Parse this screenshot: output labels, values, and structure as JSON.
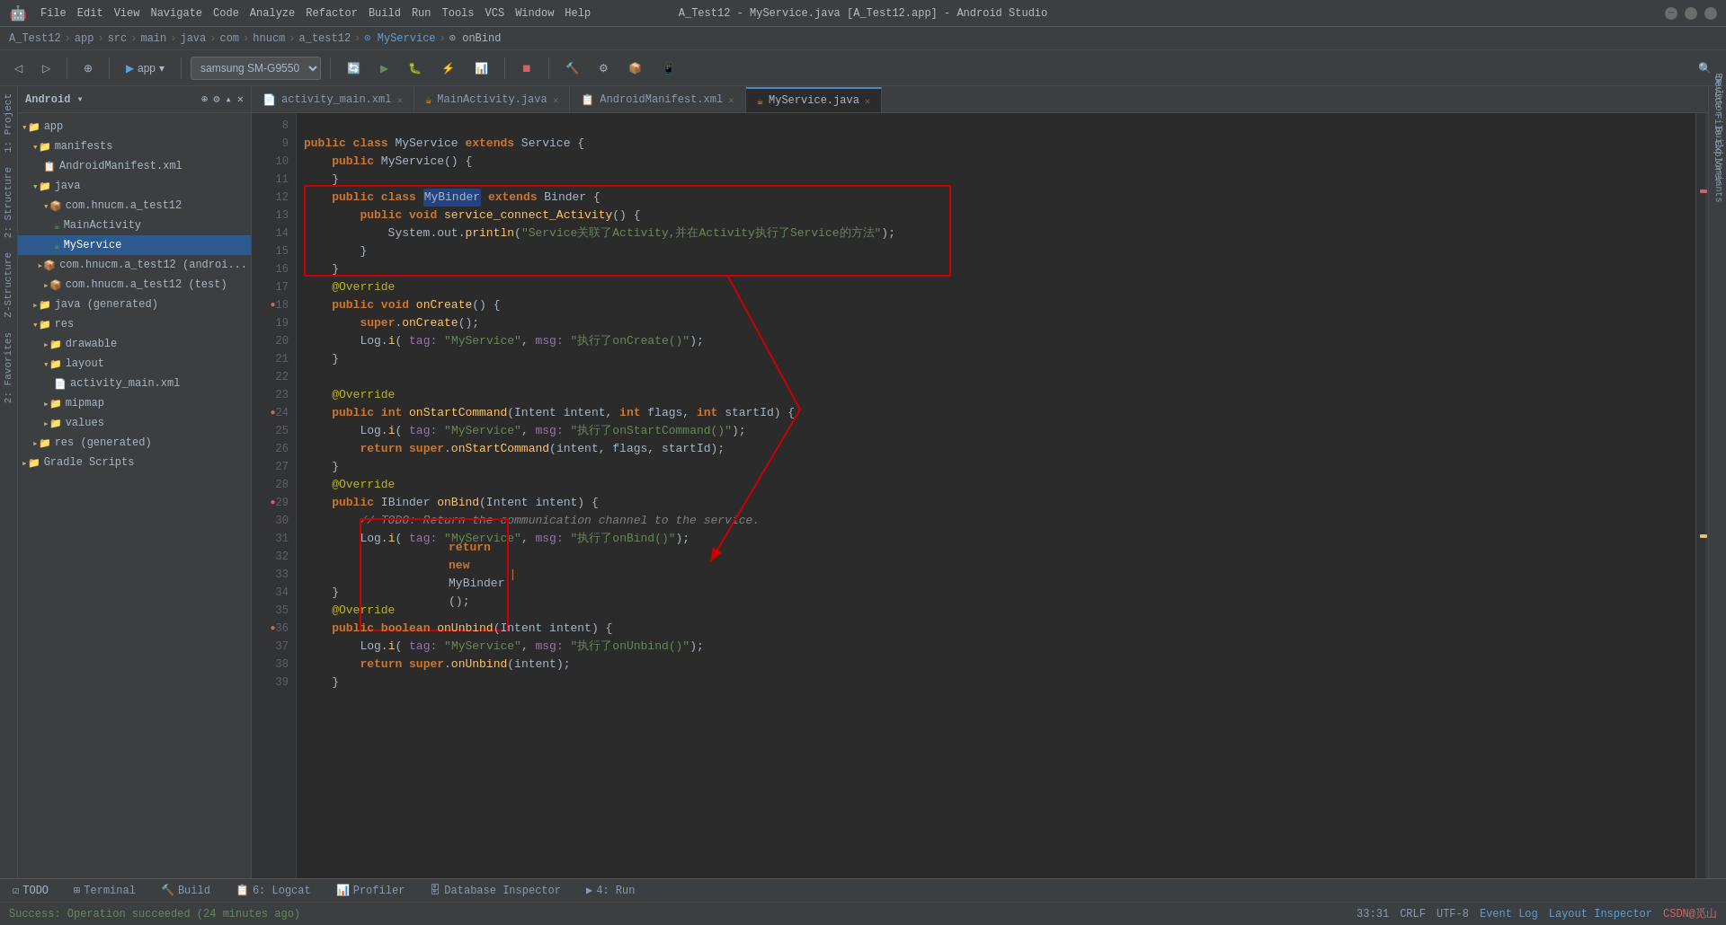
{
  "window": {
    "title": "A_Test12 - MyService.java [A_Test12.app] - Android Studio",
    "minimize": "─",
    "maximize": "□",
    "close": "✕"
  },
  "menubar": {
    "items": [
      "File",
      "Edit",
      "View",
      "Navigate",
      "Code",
      "Analyze",
      "Refactor",
      "Build",
      "Run",
      "Tools",
      "VCS",
      "Window",
      "Help"
    ]
  },
  "breadcrumb": {
    "parts": [
      "A_Test12",
      "app",
      "src",
      "main",
      "java",
      "com",
      "hnucm",
      "a_test12",
      "MyService",
      "onBind"
    ]
  },
  "toolbar": {
    "app_label": "app",
    "device": "samsung SM-G9550",
    "run_label": "▶",
    "debug_label": "🐛"
  },
  "tabs": [
    {
      "name": "activity_main.xml",
      "icon": "📄",
      "active": false
    },
    {
      "name": "MainActivity.java",
      "icon": "☕",
      "active": false
    },
    {
      "name": "AndroidManifest.xml",
      "icon": "📋",
      "active": false
    },
    {
      "name": "MyService.java",
      "icon": "☕",
      "active": true
    }
  ],
  "project_tree": {
    "title": "Android",
    "items": [
      {
        "label": "app",
        "level": 0,
        "type": "folder",
        "expanded": true
      },
      {
        "label": "manifests",
        "level": 1,
        "type": "folder",
        "expanded": true
      },
      {
        "label": "AndroidManifest.xml",
        "level": 2,
        "type": "manifest"
      },
      {
        "label": "java",
        "level": 1,
        "type": "folder",
        "expanded": true
      },
      {
        "label": "com.hnucm.a_test12",
        "level": 2,
        "type": "folder",
        "expanded": true
      },
      {
        "label": "MainActivity",
        "level": 3,
        "type": "java"
      },
      {
        "label": "MyService",
        "level": 3,
        "type": "java",
        "selected": true
      },
      {
        "label": "com.hnucm.a_test12 (androi...",
        "level": 2,
        "type": "folder"
      },
      {
        "label": "com.hnucm.a_test12 (test)",
        "level": 2,
        "type": "folder"
      },
      {
        "label": "java (generated)",
        "level": 1,
        "type": "folder"
      },
      {
        "label": "res",
        "level": 1,
        "type": "folder",
        "expanded": true
      },
      {
        "label": "drawable",
        "level": 2,
        "type": "folder"
      },
      {
        "label": "layout",
        "level": 2,
        "type": "folder",
        "expanded": true
      },
      {
        "label": "activity_main.xml",
        "level": 3,
        "type": "xml"
      },
      {
        "label": "mipmap",
        "level": 2,
        "type": "folder"
      },
      {
        "label": "values",
        "level": 2,
        "type": "folder"
      },
      {
        "label": "res (generated)",
        "level": 1,
        "type": "folder"
      },
      {
        "label": "Gradle Scripts",
        "level": 0,
        "type": "folder"
      }
    ]
  },
  "code": {
    "lines": [
      {
        "num": 8,
        "content": ""
      },
      {
        "num": 9,
        "content": "public class MyService extends Service {",
        "parts": [
          {
            "text": "public ",
            "cls": "kw"
          },
          {
            "text": "class ",
            "cls": "kw"
          },
          {
            "text": "MyService ",
            "cls": "classname"
          },
          {
            "text": "extends ",
            "cls": "kw"
          },
          {
            "text": "Service {",
            "cls": "type"
          }
        ]
      },
      {
        "num": 10,
        "content": "    public MyService() {"
      },
      {
        "num": 11,
        "content": "    }"
      },
      {
        "num": 12,
        "content": "    public class MyBinder extends Binder {",
        "highlight": true
      },
      {
        "num": 13,
        "content": "        public void service_connect_Activity() {",
        "highlight": true
      },
      {
        "num": 14,
        "content": "            System.out.println(\"Service关联了Activity,并在Activity执行了Service的方法\");",
        "highlight": true
      },
      {
        "num": 15,
        "content": "        }",
        "highlight": true
      },
      {
        "num": 16,
        "content": "    }",
        "highlight": true
      },
      {
        "num": 17,
        "content": "    @Override"
      },
      {
        "num": 18,
        "content": "    public void onCreate() {",
        "gutter": "breakpoint"
      },
      {
        "num": 19,
        "content": "        super.onCreate();"
      },
      {
        "num": 20,
        "content": "        Log.i( tag: \"MyService\", msg: \"执行了onCreate()\");"
      },
      {
        "num": 21,
        "content": "    }"
      },
      {
        "num": 22,
        "content": ""
      },
      {
        "num": 23,
        "content": "    @Override"
      },
      {
        "num": 24,
        "content": "    public int onStartCommand(Intent intent, int flags, int startId) {",
        "gutter": "breakpoint"
      },
      {
        "num": 25,
        "content": "        Log.i( tag: \"MyService\", msg: \"执行了onStartCommand()\");"
      },
      {
        "num": 26,
        "content": "        return super.onStartCommand(intent, flags, startId);"
      },
      {
        "num": 27,
        "content": "    }"
      },
      {
        "num": 28,
        "content": "    @Override"
      },
      {
        "num": 29,
        "content": "    public IBinder onBind(Intent intent) {",
        "gutter": "breakpoint"
      },
      {
        "num": 30,
        "content": "        // TODO: Return the communication channel to the service."
      },
      {
        "num": 31,
        "content": "        Log.i( tag: \"MyService\", msg: \"执行了onBind()\");"
      },
      {
        "num": 32,
        "content": ""
      },
      {
        "num": 33,
        "content": "        return new MyBinder();",
        "highlight_line": true
      },
      {
        "num": 34,
        "content": "    }"
      },
      {
        "num": 35,
        "content": "    @Override"
      },
      {
        "num": 36,
        "content": "    public boolean onUnbind(Intent intent) {",
        "gutter": "breakpoint"
      },
      {
        "num": 37,
        "content": "        Log.i( tag: \"MyService\", msg: \"执行了onUnbind()\");"
      },
      {
        "num": 38,
        "content": "        return super.onUnbind(intent);"
      },
      {
        "num": 39,
        "content": "    }"
      }
    ]
  },
  "status_bar": {
    "message": "Success: Operation succeeded (24 minutes ago)",
    "position": "33:31",
    "line_sep": "CRLF",
    "encoding": "UTF-8",
    "event_log": "Event Log",
    "layout_inspector": "Layout Inspector"
  },
  "bottom_tabs": [
    {
      "label": "TODO",
      "icon": "☑"
    },
    {
      "label": "Terminal",
      "icon": ">"
    },
    {
      "label": "Build",
      "icon": "🔨"
    },
    {
      "label": "6: Logcat",
      "icon": "📋"
    },
    {
      "label": "Profiler",
      "icon": "📊"
    },
    {
      "label": "Database Inspector",
      "icon": "🗄"
    },
    {
      "label": "4: Run",
      "icon": "▶"
    }
  ],
  "side_panels": {
    "left": [
      "1: Project",
      "2: Structure",
      "Z-Structure",
      "2: Favorites"
    ],
    "right": [
      "Emulator",
      "Device File Explorer",
      "Build Variants"
    ]
  }
}
